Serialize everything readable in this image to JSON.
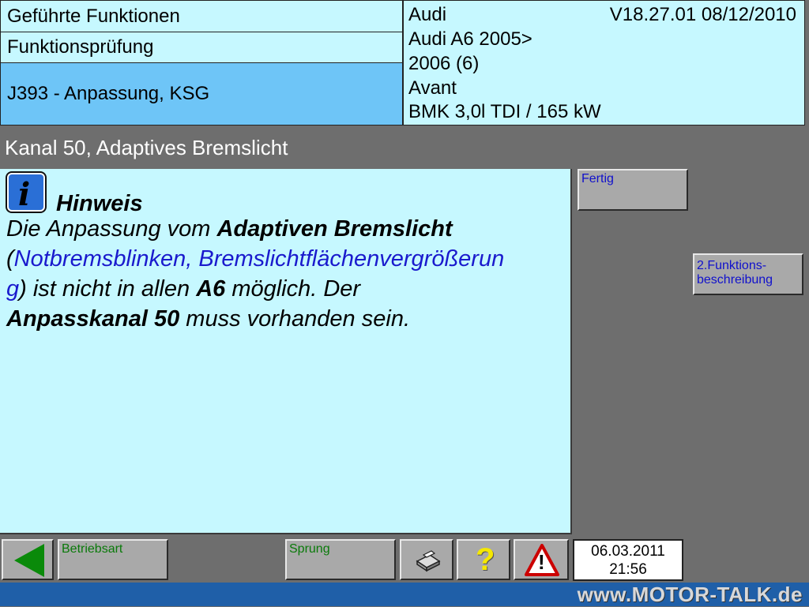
{
  "header": {
    "guided_functions": "Geführte Funktionen",
    "function_test": "Funktionsprüfung",
    "module": "J393 - Anpassung, KSG"
  },
  "vehicle": {
    "brand": "Audi",
    "version": "V18.27.01 08/12/2010",
    "model": "Audi A6 2005>",
    "year": "2006 (6)",
    "body": "Avant",
    "engine": "BMK 3,0l TDI / 165 kW"
  },
  "title_bar": {
    "title": "Kanal 50, Adaptives Bremslicht"
  },
  "message": {
    "heading": "Hinweis",
    "t1": "Die Anpassung vom ",
    "b1": "Adaptiven Bremslicht",
    "t2": "(",
    "l1": "Notbremsblinken, Bremslichtflächenvergrößerun",
    "l2": "g",
    "t3": ") ist nicht in allen ",
    "b2": "A6",
    "t4": " möglich. Der",
    "b3": "Anpasskanal 50",
    "t5": " muss vorhanden sein."
  },
  "buttons": {
    "fertig": "Fertig",
    "function_desc_1": "2.Funktions-",
    "function_desc_2": "beschreibung",
    "betriebsart": "Betriebsart",
    "sprung": "Sprung",
    "help": "?",
    "warning": "!"
  },
  "datetime": {
    "date": "06.03.2011",
    "time": "21:56"
  },
  "watermark": "www.MOTOR-TALK.de",
  "colors": {
    "panel": "#c6f8ff",
    "selected": "#6ec5f7",
    "background": "#6e6e6e",
    "bottom_bar": "#1f5fa8"
  }
}
